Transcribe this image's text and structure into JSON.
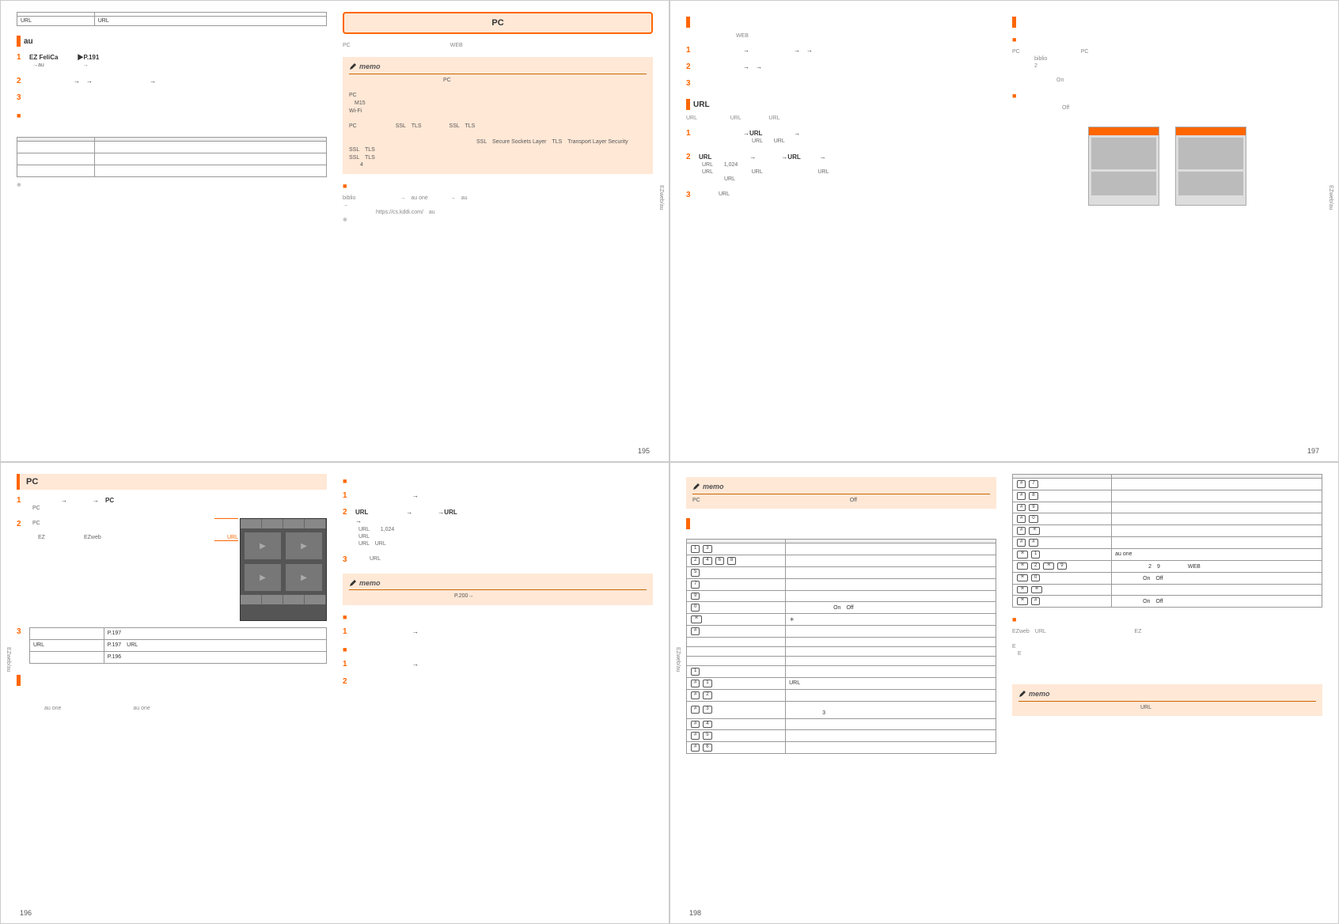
{
  "sideTab": "EZweb/au",
  "p195": {
    "num": "195",
    "tbl": {
      "r1c1": "",
      "r1c2": "",
      "r2c1": "URL",
      "r2c2": "URL"
    },
    "auSect": "au",
    "s1": "EZ FeliCa　　　▶P.191",
    "s1b": "→au　　　　　　　→",
    "s2": "　　　　　　　→　→　　　　　　　　　→　",
    "s3": "",
    "sub1": "",
    "tbl2h1": "",
    "tbl2h2": "",
    "foot": "※",
    "title": "PC",
    "intro": "PC　　　　　　　　　　　　　　　　　　WEB",
    "memo1": "　　　　　　　　　　　　　　　　　PC\n\nPC\n　M15\nWi-Fi\n\nPC　　　　　　　SSL　TLS　　　　　SSL　TLS\n\n　　　　　　　　　　　　　　　　　　　　　　　SSL　Secure Sockets Layer　TLS　Transport Layer Security\nSSL　TLS\nSSL　TLS\n　　4",
    "sub2": "",
    "body2": "biblio　　　　　　　　→　au one　　　　→　au\n→\n　　　　　　https://cs.kddi.com/　au\n※"
  },
  "p197": {
    "num": "197",
    "sect1": "",
    "intro1": "　　　　　　　　　WEB",
    "s1": "　　　　　　　→　　　　　　　→　→",
    "s2": "　　　　　　　→　→",
    "s2sub": "",
    "s3": "",
    "urlSect": "URL",
    "urlIntro": "URL　　　　　　URL　　　　　URL",
    "u1": "　　　　　　　→URL　　　　　→",
    "u1sub": "　　　　　　　　　URL　　URL",
    "u2": "URL　　　　　　→　　　　→URL　　　→",
    "u2sub": "URL　　1,024\nURL　　　　　　　URL　　　　　　　　　　URL\n　　　　URL",
    "u3": "",
    "u3sub": "　　　URL",
    "sect2": "",
    "sub21": "",
    "body21": "PC　　　　　　　　　　　PC\n　　　　biblio\n　　　　2\n\n　　　　　　　　On",
    "sub22": "",
    "body22": "　　　　　　　　　Off",
    "body23": "",
    "cap1": "",
    "cap2": ""
  },
  "p196": {
    "num": "196",
    "title": "PC",
    "s1": "　　　　　→　　　　→　PC",
    "s1sub": "PC",
    "s2": "",
    "s2sub": "PC\n\n　EZ　　　　　　　EZweb",
    "callout1": "",
    "callout2": "URL",
    "tbl": {
      "r1c1": "",
      "r1c2": "P.197",
      "r2c1": "URL",
      "r2c2": "P.197　URL",
      "r3c1": "",
      "r3c2": "P.196"
    },
    "sect2": "",
    "body2": "\n\n　　　　　au one　　　　　　　　　　　　　au one",
    "sub1": "",
    "r1": "　　　　　　　　　→",
    "r2a": "URL　　　　　　→　　　　→URL",
    "r2b": "→",
    "r2sub": "URL　　1,024\nURL\nURL　URL",
    "r3": "",
    "r3sub": "　　URL",
    "memo": "　　　　　　　　　　　　　　　　　　　P.200→",
    "sub2": "",
    "q1": "　　　　　　　　　→",
    "sub3": "",
    "w1": "　　　　　　　　　→　　　",
    "w2": ""
  },
  "p198": {
    "num": "198",
    "memo1": "PC　　　　　　　　　　　　　　　　　　　　　　　　　　　Off",
    "sect1": "",
    "intro1": "",
    "tbl1h1": "",
    "tbl1h2": "",
    "t1": [
      [
        "1　3",
        ""
      ],
      [
        "2　4　6\n8",
        ""
      ],
      [
        "5",
        ""
      ],
      [
        "7",
        ""
      ],
      [
        "9",
        ""
      ],
      [
        "0",
        "　　　　　　　　On　Off"
      ],
      [
        "＊",
        "＊"
      ],
      [
        "#",
        ""
      ],
      [
        "　",
        ""
      ],
      [
        "",
        ""
      ],
      [
        "",
        ""
      ],
      [
        "　1",
        ""
      ],
      [
        "#　1",
        "URL"
      ],
      [
        "#　2",
        ""
      ],
      [
        "#　3",
        "\n　　　　　　3"
      ],
      [
        "#　4",
        ""
      ],
      [
        "#　5",
        ""
      ],
      [
        "#　6",
        ""
      ]
    ],
    "tbl2h1": "",
    "tbl2h2": "",
    "t2": [
      [
        "#　7",
        ""
      ],
      [
        "#　8",
        ""
      ],
      [
        "#　9",
        ""
      ],
      [
        "#　0",
        ""
      ],
      [
        "#　＊",
        ""
      ],
      [
        "#　#",
        ""
      ],
      [
        "＊　1",
        "au one"
      ],
      [
        "＊　2　＊　9",
        "　　　　　　2　9　　　　　WEB"
      ],
      [
        "＊　0",
        "　　　　　On　Off"
      ],
      [
        "＊　＊",
        ""
      ],
      [
        "＊　#",
        "　　　　　On　Off"
      ]
    ],
    "sub2": "",
    "body2": "EZweb　URL　　　　　　　　　　　　　　　　EZ\n\nE\n　E",
    "memo2": "　　　　　　　　　　　　　　　　　　　　　　URL"
  }
}
